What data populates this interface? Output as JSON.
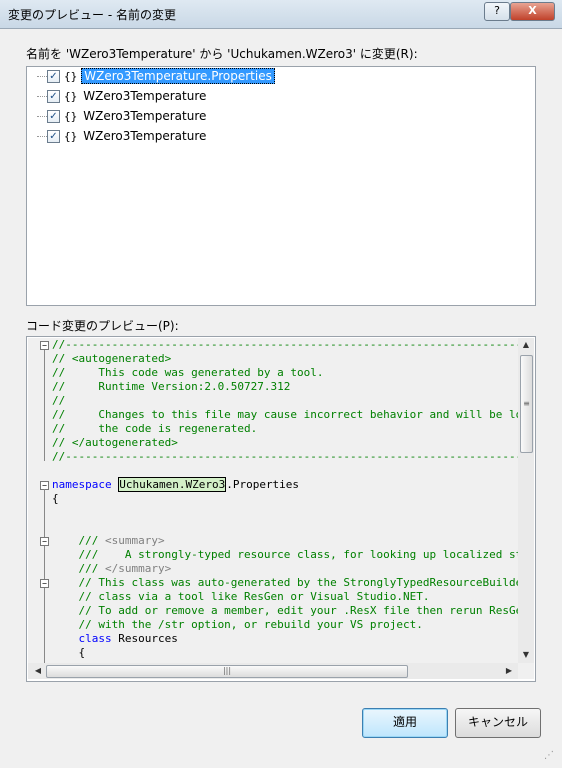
{
  "window": {
    "title": "変更のプレビュー - 名前の変更",
    "help_label": "?",
    "close_label": "X"
  },
  "rename_label": "名前を 'WZero3Temperature' から 'Uchukamen.WZero3' に変更(R):",
  "tree": {
    "items": [
      {
        "braces": "{}",
        "label": "WZero3Temperature.Properties",
        "checked": true,
        "selected": true
      },
      {
        "braces": "{}",
        "label": "WZero3Temperature",
        "checked": true,
        "selected": false
      },
      {
        "braces": "{}",
        "label": "WZero3Temperature",
        "checked": true,
        "selected": false
      },
      {
        "braces": "{}",
        "label": "WZero3Temperature",
        "checked": true,
        "selected": false
      }
    ],
    "check_glyph": "✓"
  },
  "preview_label": "コード変更のプレビュー(P):",
  "code": {
    "lines": [
      "//------------------------------------------------------------------------------",
      "// <autogenerated>",
      "//     This code was generated by a tool.",
      "//     Runtime Version:2.0.50727.312",
      "//",
      "//     Changes to this file may cause incorrect behavior and will be lost if",
      "//     the code is regenerated.",
      "// </autogenerated>",
      "//------------------------------------------------------------------------------",
      "",
      "namespace",
      "Uchukamen.WZero3",
      ".Properties",
      "{",
      "",
      "",
      "    /// ",
      "<summary>",
      "    ///    A strongly-typed resource class, for looking up localized strings, etc.",
      "    /// ",
      "</summary>",
      "    // This class was auto-generated by the StronglyTypedResourceBuilder",
      "    // class via a tool like ResGen or Visual Studio.NET.",
      "    // To add or remove a member, edit your .ResX file then rerun ResGen",
      "    // with the /str option, or rebuild your VS project.",
      "    class",
      " Resources",
      "    {"
    ]
  },
  "buttons": {
    "apply": "適用",
    "cancel": "キャンセル"
  }
}
